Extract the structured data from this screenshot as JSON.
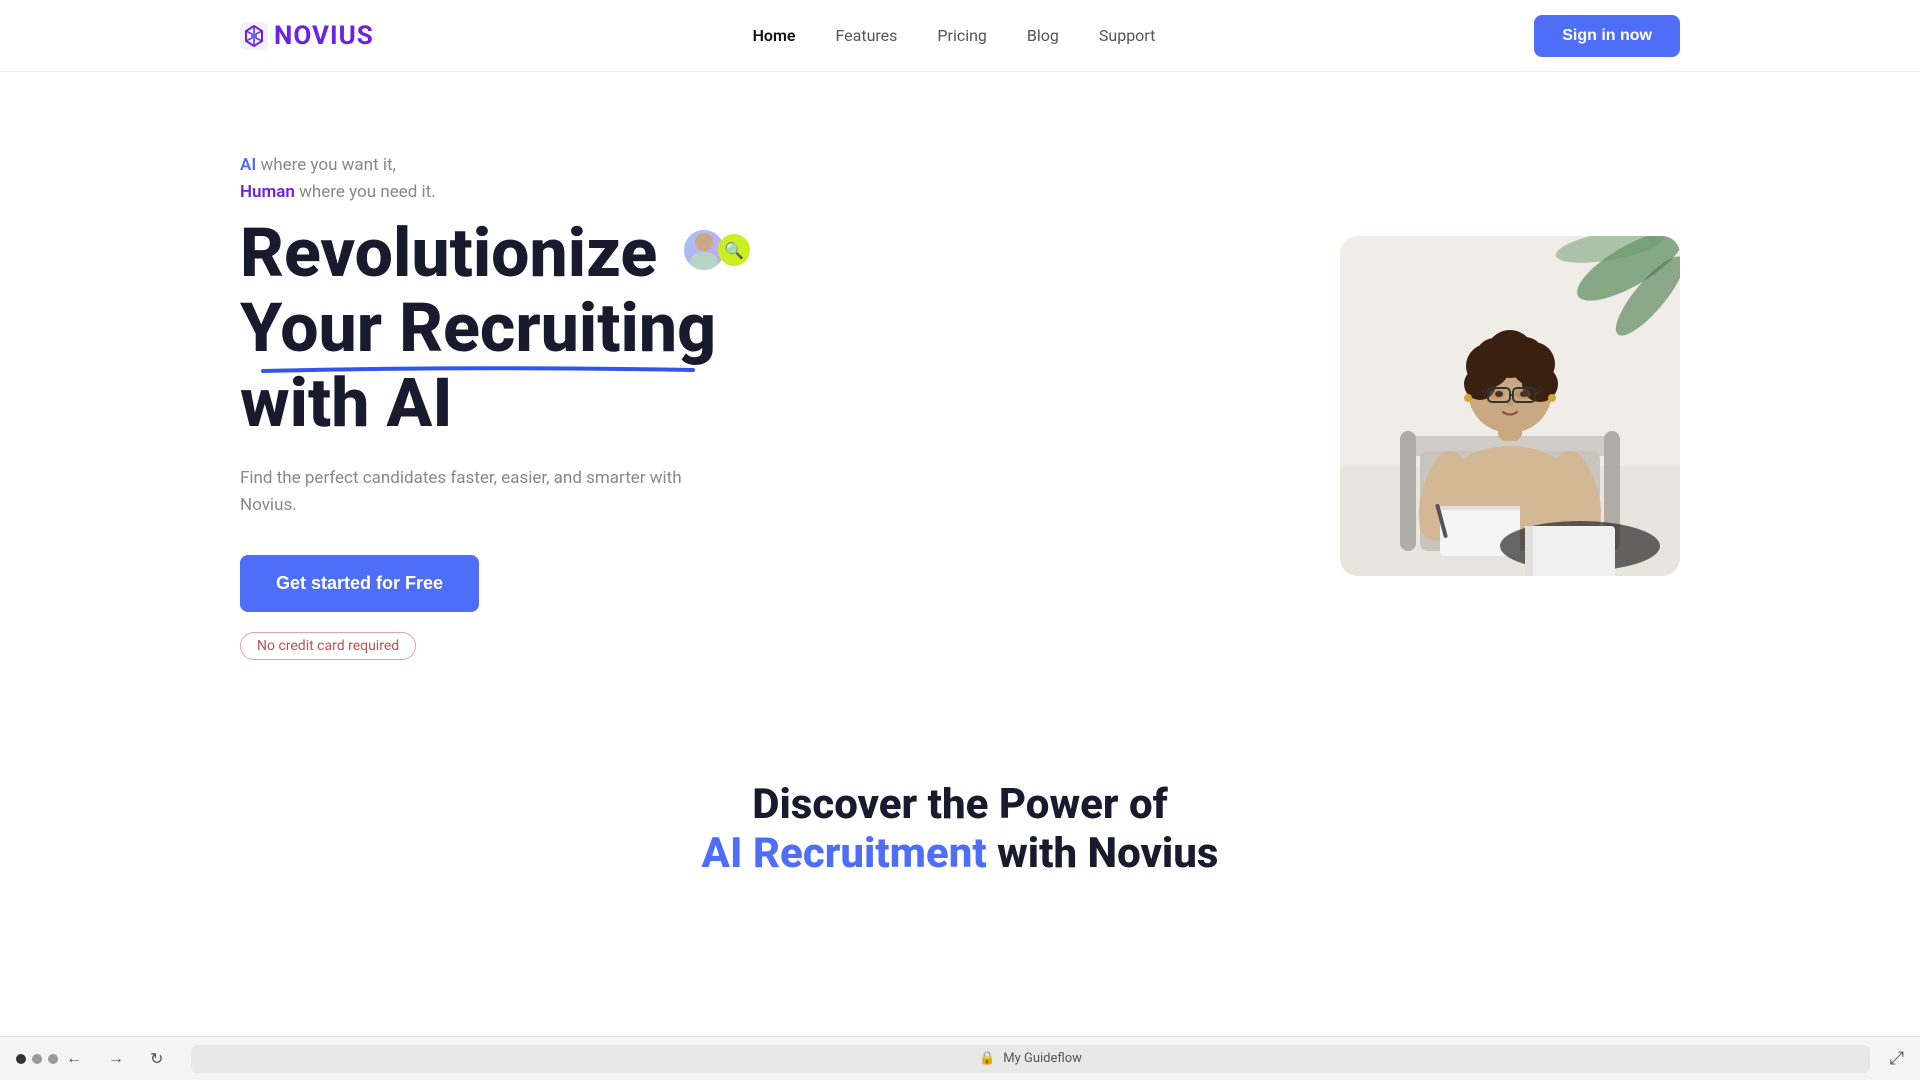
{
  "nav": {
    "logo": "NOVIUS",
    "links": [
      {
        "label": "Home",
        "active": true
      },
      {
        "label": "Features",
        "active": false
      },
      {
        "label": "Pricing",
        "active": false
      },
      {
        "label": "Blog",
        "active": false
      },
      {
        "label": "Support",
        "active": false
      }
    ],
    "signin_label": "Sign in now"
  },
  "hero": {
    "tagline_ai": "AI",
    "tagline_ai_suffix": " where you want it,",
    "tagline_human": "Human",
    "tagline_human_suffix": " where you need it.",
    "heading_line1": "Revolutionize",
    "heading_line2": "Your Recruiting",
    "heading_line3": "with AI",
    "description": "Find the perfect candidates faster, easier, and smarter with Novius.",
    "cta_label": "Get started for Free",
    "no_card_label": "No credit card required"
  },
  "discover": {
    "title_prefix": "Discover the Power of",
    "title_highlight": "AI Recruitment",
    "title_suffix": " with Novius"
  },
  "bottom_bar": {
    "address": "My Guideflow",
    "lock_icon": "🔒"
  }
}
